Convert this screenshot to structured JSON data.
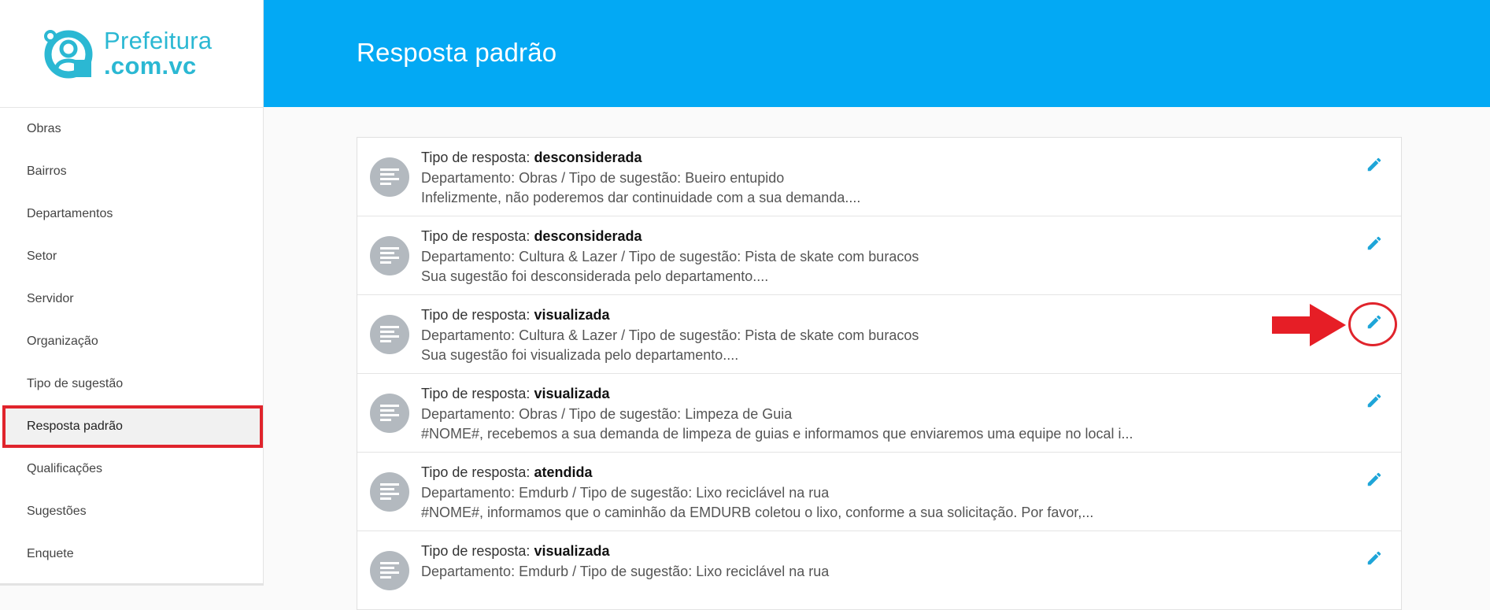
{
  "app": {
    "logo_line1": "Prefeitura",
    "logo_line2": ".com.vc",
    "brand_color": "#2bb8d3"
  },
  "sidebar": {
    "items": [
      {
        "label": "Obras"
      },
      {
        "label": "Bairros"
      },
      {
        "label": "Departamentos"
      },
      {
        "label": "Setor"
      },
      {
        "label": "Servidor"
      },
      {
        "label": "Organização"
      },
      {
        "label": "Tipo de sugestão"
      },
      {
        "label": "Resposta padrão",
        "active": true
      },
      {
        "label": "Qualificações"
      },
      {
        "label": "Sugestões"
      },
      {
        "label": "Enquete"
      }
    ]
  },
  "header": {
    "title": "Resposta padrão",
    "color": "#03a9f4"
  },
  "list": {
    "type_prefix": "Tipo de resposta:",
    "edit_icon": "pencil-icon",
    "item_icon": "notes-icon",
    "accent": "#1ea5d8",
    "items": [
      {
        "type": "desconsiderada",
        "department_line": "Departamento: Obras / Tipo de sugestão: Bueiro entupido",
        "preview": "Infelizmente, não poderemos dar continuidade com a sua demanda...."
      },
      {
        "type": "desconsiderada",
        "department_line": "Departamento: Cultura & Lazer / Tipo de sugestão: Pista de skate com buracos",
        "preview": "Sua sugestão foi desconsiderada pelo departamento...."
      },
      {
        "type": "visualizada",
        "department_line": "Departamento: Cultura & Lazer / Tipo de sugestão: Pista de skate com buracos",
        "preview": "Sua sugestão foi visualizada pelo departamento...."
      },
      {
        "type": "visualizada",
        "department_line": "Departamento: Obras / Tipo de sugestão: Limpeza de Guia",
        "preview": "#NOME#, recebemos a sua demanda de limpeza de guias e informamos que enviaremos uma equipe no local i..."
      },
      {
        "type": "atendida",
        "department_line": "Departamento: Emdurb / Tipo de sugestão: Lixo reciclável na rua",
        "preview": "#NOME#, informamos que o caminhão da EMDURB coletou o lixo, conforme a sua solicitação. Por favor,..."
      },
      {
        "type": "visualizada",
        "department_line": "Departamento: Emdurb / Tipo de sugestão: Lixo reciclável na rua",
        "preview": ""
      }
    ]
  },
  "annotation": {
    "highlight_color": "#e0242c",
    "arrow_icon": "arrow-right-icon"
  }
}
